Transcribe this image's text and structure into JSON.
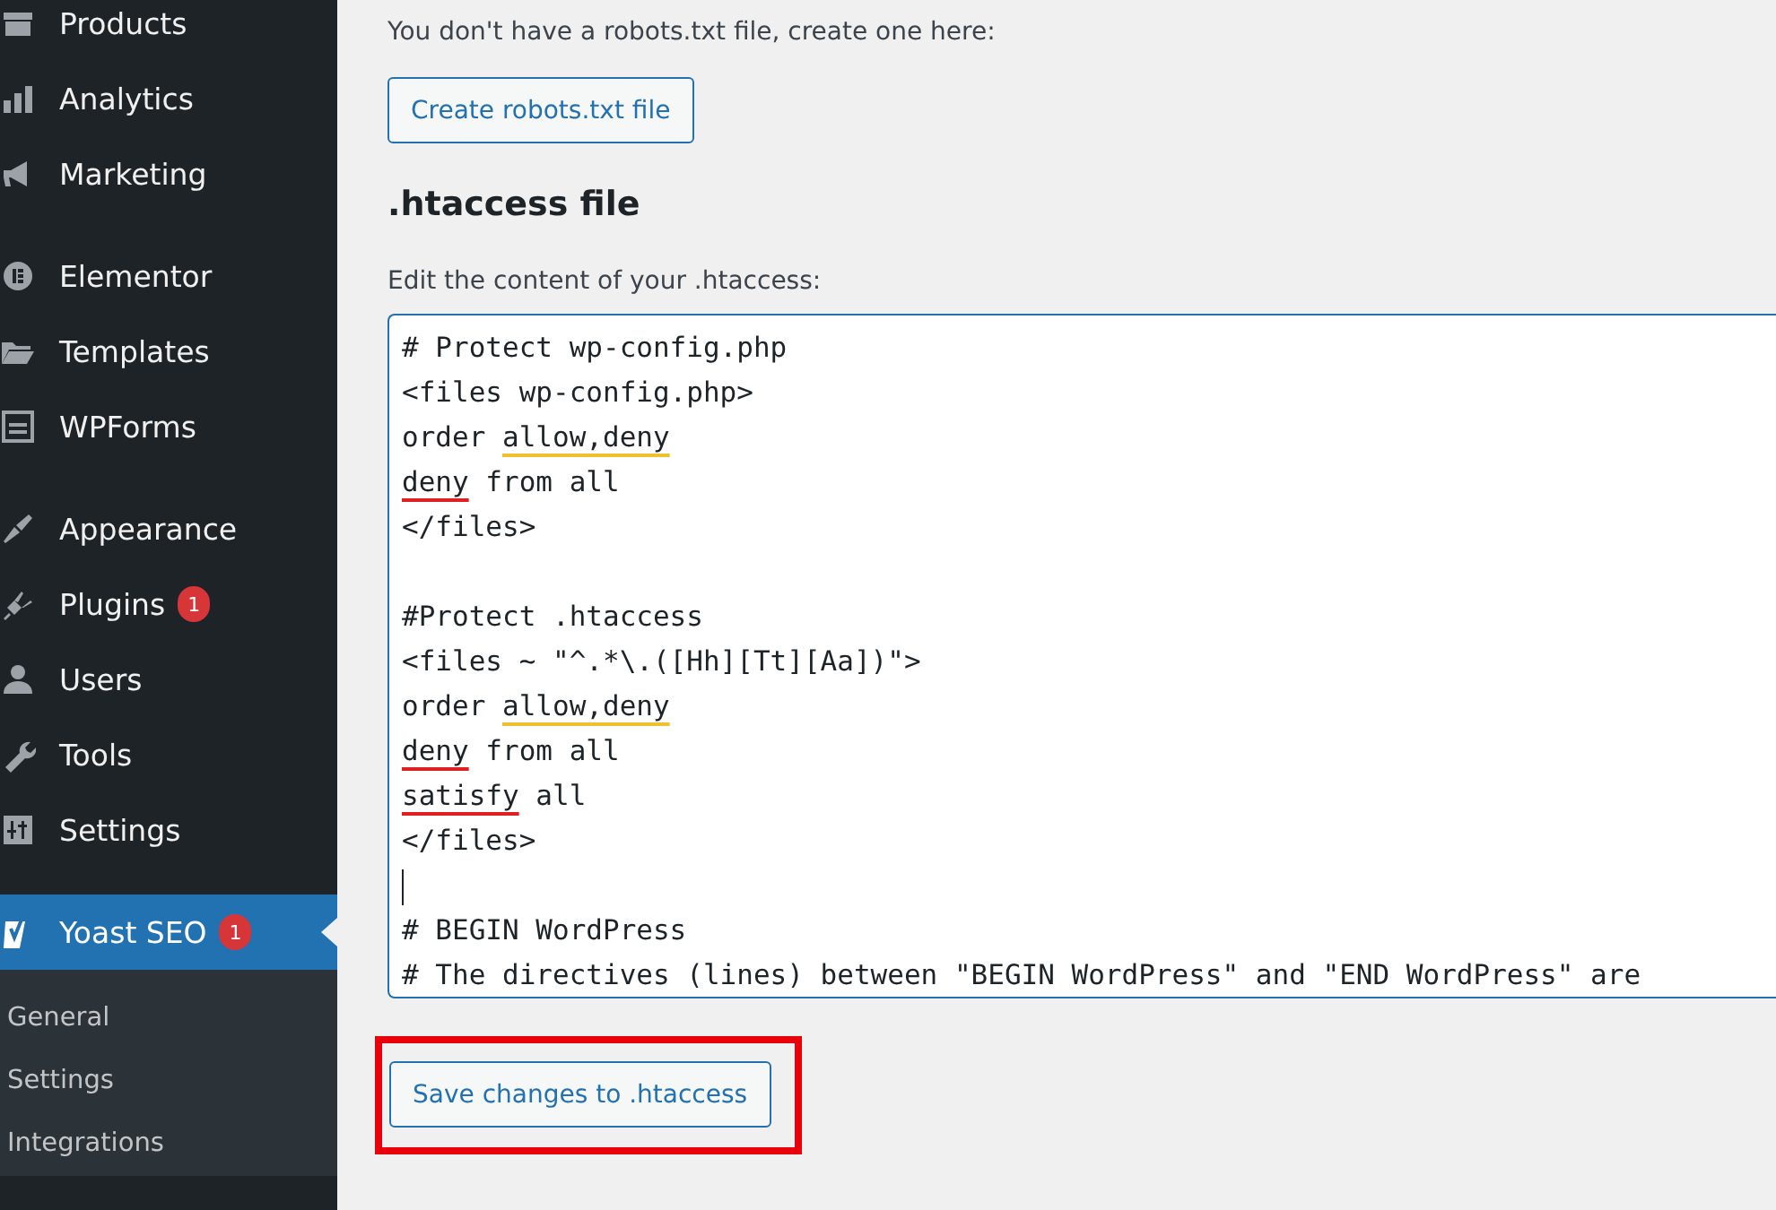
{
  "sidebar": {
    "sections": [
      {
        "items": [
          {
            "label": "Products",
            "selected": false
          },
          {
            "label": "Analytics",
            "selected": false
          },
          {
            "label": "Marketing",
            "selected": false
          }
        ]
      },
      {
        "items": [
          {
            "label": "Elementor",
            "selected": false
          },
          {
            "label": "Templates",
            "selected": false
          },
          {
            "label": "WPForms",
            "selected": false
          }
        ]
      },
      {
        "items": [
          {
            "label": "Appearance",
            "selected": false
          },
          {
            "label": "Plugins",
            "badge": "1",
            "selected": false
          },
          {
            "label": "Users",
            "selected": false
          },
          {
            "label": "Tools",
            "selected": false
          },
          {
            "label": "Settings",
            "selected": false
          }
        ]
      },
      {
        "items": [
          {
            "label": "Yoast SEO",
            "badge": "1",
            "selected": true,
            "submenu": [
              "General",
              "Settings",
              "Integrations"
            ]
          }
        ]
      }
    ]
  },
  "robots": {
    "text": "You don't have a robots.txt file, create one here:",
    "button": "Create robots.txt file"
  },
  "htaccess": {
    "heading": ".htaccess file",
    "label": "Edit the content of your .htaccess:",
    "lines": [
      {
        "kind": "text",
        "segments": [
          {
            "kind": "plain",
            "text": "# Protect wp-config.php"
          }
        ]
      },
      {
        "kind": "text",
        "segments": [
          {
            "kind": "plain",
            "text": "<files wp-config.php>"
          }
        ]
      },
      {
        "kind": "text",
        "segments": [
          {
            "kind": "plain",
            "text": "order "
          },
          {
            "kind": "grammar",
            "text": "allow,deny"
          }
        ]
      },
      {
        "kind": "text",
        "segments": [
          {
            "kind": "spelling",
            "text": "deny"
          },
          {
            "kind": "plain",
            "text": " from all"
          }
        ]
      },
      {
        "kind": "text",
        "segments": [
          {
            "kind": "plain",
            "text": "</files>"
          }
        ]
      },
      {
        "kind": "blank"
      },
      {
        "kind": "text",
        "segments": [
          {
            "kind": "plain",
            "text": "#Protect .htaccess"
          }
        ]
      },
      {
        "kind": "text",
        "segments": [
          {
            "kind": "plain",
            "text": "<files ~ \"^.*\\.([Hh][Tt][Aa])\">"
          }
        ]
      },
      {
        "kind": "text",
        "segments": [
          {
            "kind": "plain",
            "text": "order "
          },
          {
            "kind": "grammar",
            "text": "allow,deny"
          }
        ]
      },
      {
        "kind": "text",
        "segments": [
          {
            "kind": "spelling",
            "text": "deny"
          },
          {
            "kind": "plain",
            "text": " from all"
          }
        ]
      },
      {
        "kind": "text",
        "segments": [
          {
            "kind": "spelling",
            "text": "satisfy"
          },
          {
            "kind": "plain",
            "text": " all"
          }
        ]
      },
      {
        "kind": "text",
        "segments": [
          {
            "kind": "plain",
            "text": "</files>"
          }
        ]
      },
      {
        "kind": "caret"
      },
      {
        "kind": "text",
        "segments": [
          {
            "kind": "plain",
            "text": "# BEGIN WordPress"
          }
        ]
      },
      {
        "kind": "text",
        "segments": [
          {
            "kind": "plain",
            "text": "# The directives (lines) between \"BEGIN WordPress\" and \"END WordPress\" are"
          }
        ]
      }
    ],
    "button": "Save changes to .htaccess",
    "highlighted": true
  }
}
